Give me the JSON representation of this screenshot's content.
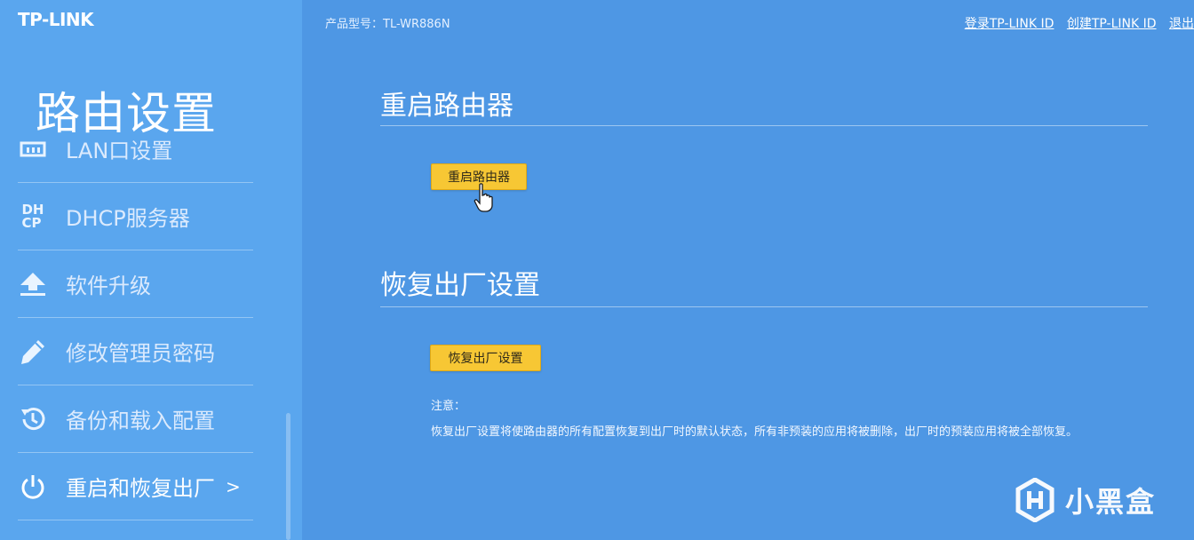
{
  "brand": {
    "logo": "TP-LINK"
  },
  "header": {
    "model_label": "产品型号：TL-WR886N",
    "links": {
      "login": "登录TP-LINK ID",
      "create": "创建TP-LINK ID",
      "logout": "退出"
    }
  },
  "sidebar": {
    "title": "路由设置",
    "items": [
      {
        "label": "LAN口设置",
        "icon": "network-icon"
      },
      {
        "label": "DHCP服务器",
        "icon": "dhcp-icon"
      },
      {
        "label": "软件升级",
        "icon": "upload-icon"
      },
      {
        "label": "修改管理员密码",
        "icon": "pencil-icon"
      },
      {
        "label": "备份和载入配置",
        "icon": "history-icon"
      },
      {
        "label": "重启和恢复出厂",
        "icon": "power-icon",
        "active": true,
        "arrow": ">"
      }
    ]
  },
  "main": {
    "reboot": {
      "heading": "重启路由器",
      "button": "重启路由器"
    },
    "factory_reset": {
      "heading": "恢复出厂设置",
      "button": "恢复出厂设置",
      "note_title": "注意：",
      "note_text": "恢复出厂设置将使路由器的所有配置恢复到出厂时的默认状态，所有非预装的应用将被删除，出厂时的预装应用将被全部恢复。"
    }
  },
  "watermark": {
    "text": "小黑盒"
  },
  "colors": {
    "main_bg": "#4e97e4",
    "sidebar_bg": "#5aa6ee",
    "button_bg": "#f7c734"
  }
}
